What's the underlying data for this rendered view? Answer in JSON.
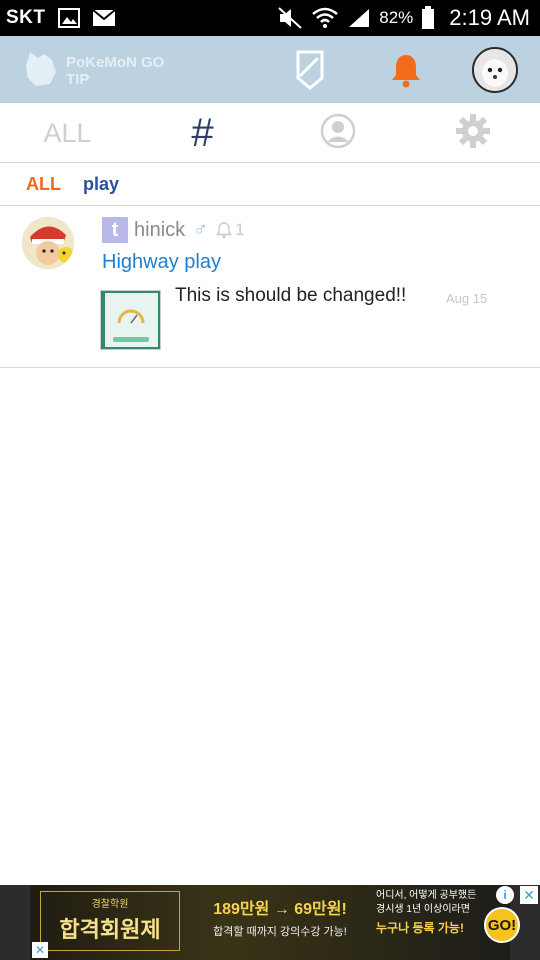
{
  "status_bar": {
    "carrier": "SKT",
    "battery": "82%",
    "time": "2:19 AM",
    "icons": [
      "gallery-icon",
      "mail-icon",
      "mute-icon",
      "wifi-icon",
      "signal-icon",
      "battery-icon"
    ]
  },
  "header": {
    "logo_text": "PoKeMoN GO TIP",
    "icons": [
      "tag-icon",
      "bell-icon",
      "profile-avatar"
    ],
    "bell_color": "#f26b1d",
    "background": "#bcd2e1"
  },
  "tabs": [
    {
      "label": "ALL"
    },
    {
      "label": "#"
    },
    {
      "icon": "person-icon"
    },
    {
      "icon": "gear-icon"
    }
  ],
  "filter": {
    "all": "ALL",
    "play": "play"
  },
  "post": {
    "badge": "t",
    "author": "hinick",
    "gender": "♂",
    "likes": "1",
    "title": "Highway play",
    "body": "This is should be changed!!",
    "date": "Aug 15"
  },
  "ad": {
    "left_small": "경찰학원",
    "left_big": "합격회원제",
    "price": "189만원 → 69만원!",
    "price_sub": "합격할 때까지 강의수강 가능!",
    "right_line1": "어디서, 어떻게 공부했든",
    "right_line2": "경시생 1년 이상이라면",
    "right_cta": "누구나 등록 가능!",
    "go": "GO!",
    "info": "i",
    "close": "✕"
  }
}
